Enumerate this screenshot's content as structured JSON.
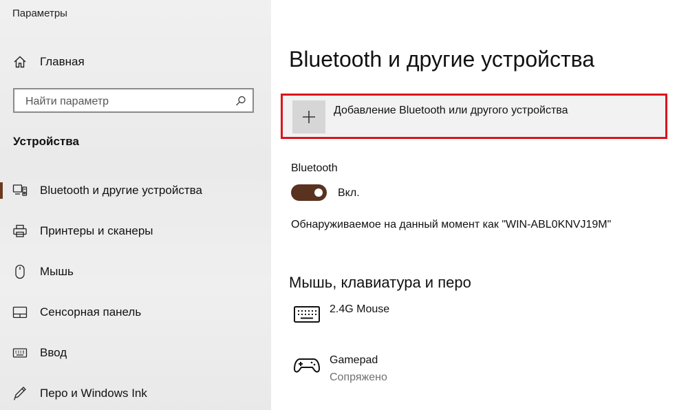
{
  "window": {
    "title": "Параметры"
  },
  "sidebar": {
    "home_label": "Главная",
    "search": {
      "placeholder": "Найти параметр"
    },
    "section_title": "Устройства",
    "items": [
      {
        "label": "Bluetooth и другие устройства",
        "icon": "bluetooth-devices-icon",
        "active": true
      },
      {
        "label": "Принтеры и сканеры",
        "icon": "printer-icon",
        "active": false
      },
      {
        "label": "Мышь",
        "icon": "mouse-icon",
        "active": false
      },
      {
        "label": "Сенсорная панель",
        "icon": "touchpad-icon",
        "active": false
      },
      {
        "label": "Ввод",
        "icon": "keyboard-icon",
        "active": false
      },
      {
        "label": "Перо и Windows Ink",
        "icon": "pen-icon",
        "active": false
      }
    ]
  },
  "main": {
    "title": "Bluetooth и другие устройства",
    "add_device_label": "Добавление Bluetooth или другого устройства",
    "bluetooth": {
      "label": "Bluetooth",
      "state": "Вкл.",
      "on": true
    },
    "discoverable_text": "Обнаруживаемое на данный момент как \"WIN-ABL0KNVJ19M\"",
    "section_title": "Мышь, клавиатура и перо",
    "devices": [
      {
        "name": "2.4G Mouse",
        "status": "",
        "icon": "keyboard-icon"
      },
      {
        "name": "Gamepad",
        "status": "Сопряжено",
        "icon": "gamepad-icon"
      }
    ]
  },
  "colors": {
    "accent": "#5a3220",
    "highlight_border": "#d9141b",
    "sidebar_bg": "#eeeeee"
  }
}
